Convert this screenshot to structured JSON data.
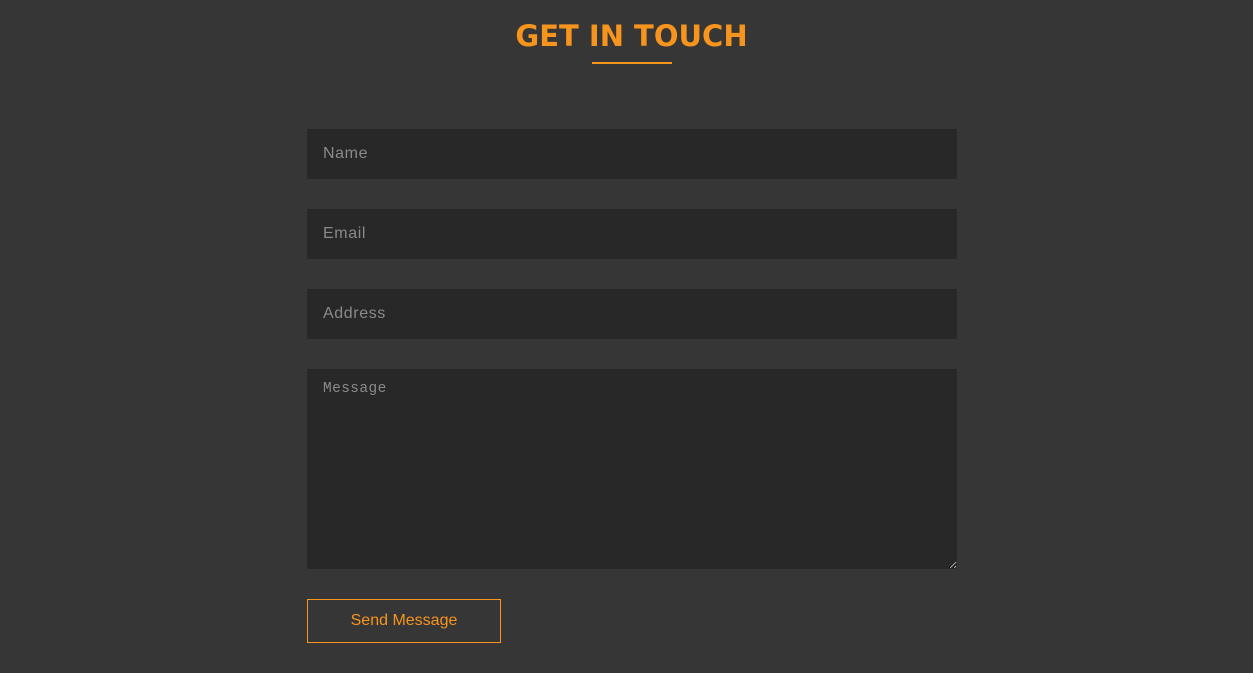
{
  "contact": {
    "title": "GET IN TOUCH",
    "accent_color": "#f7941d",
    "background_color": "#363636",
    "field_background": "#282828",
    "fields": {
      "name_placeholder": "Name",
      "email_placeholder": "Email",
      "address_placeholder": "Address",
      "message_placeholder": "Message"
    },
    "submit_label": "Send Message"
  }
}
